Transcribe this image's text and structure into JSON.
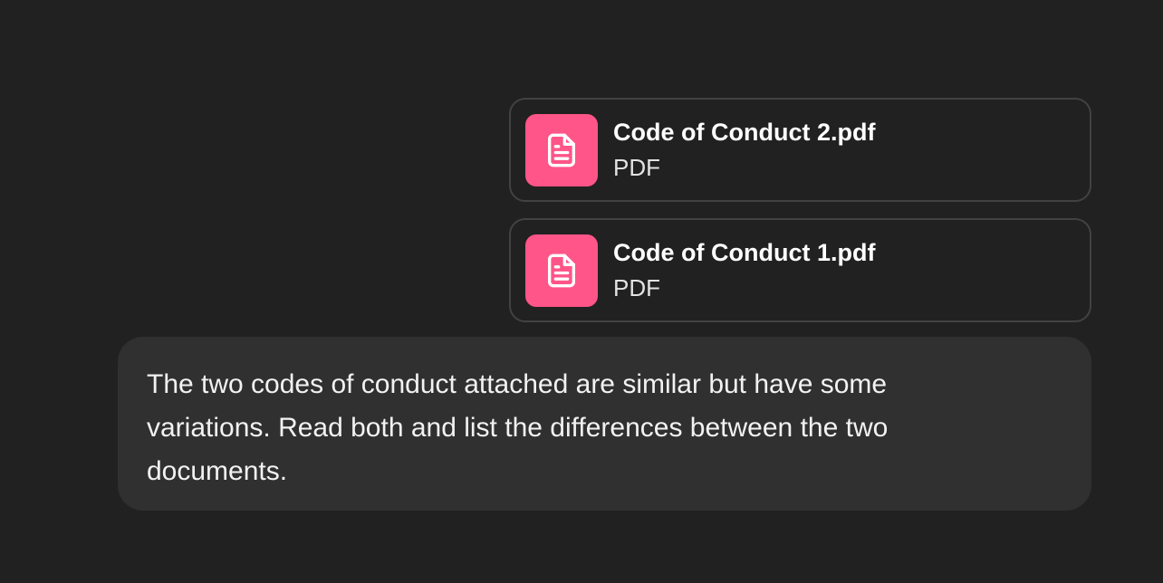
{
  "attachments": [
    {
      "name": "Code of Conduct 2.pdf",
      "type": "PDF",
      "icon": "document-icon"
    },
    {
      "name": "Code of Conduct 1.pdf",
      "type": "PDF",
      "icon": "document-icon"
    }
  ],
  "message": {
    "text": "The two codes of conduct attached are similar but have some variations. Read both and list the differences between the two documents."
  },
  "colors": {
    "background": "#212121",
    "bubble": "#303030",
    "card_border": "#424242",
    "file_icon_bg": "#ff5588"
  }
}
